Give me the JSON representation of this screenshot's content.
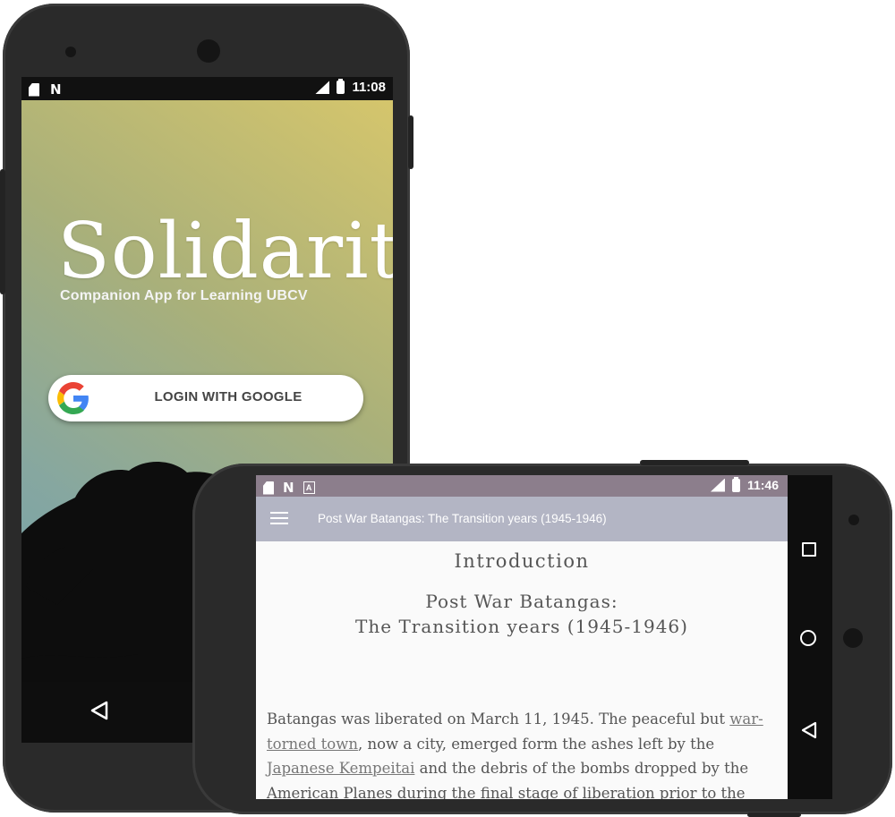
{
  "portrait": {
    "status_time": "11:08",
    "status_left_icons": [
      "sim-card-icon",
      "nfc-icon"
    ],
    "status_right_icons": [
      "lte-signal-icon",
      "battery-icon"
    ],
    "app_title": "Solidarity",
    "app_subtitle": "Companion App for Learning UBCV",
    "login_button_label": "LOGIN WITH GOOGLE",
    "nav_icons": [
      "back-icon"
    ]
  },
  "landscape": {
    "status_time": "11:46",
    "status_left_icons": [
      "sim-card-icon",
      "nfc-icon",
      "a-icon"
    ],
    "status_right_icons": [
      "lte-signal-icon",
      "battery-icon"
    ],
    "toolbar_title": "Post War Batangas: The Transition years (1945-1946)",
    "heading": "Introduction",
    "subtitle_line1": "Post War Batangas:",
    "subtitle_line2": "The Transition years (1945-1946)",
    "body": {
      "seg1": "Batangas was liberated on March 11, 1945. The peaceful but ",
      "link1": "war-torned town",
      "seg2": ", now a city, emerged form the ashes left by the ",
      "link2": "Japanese Kempeitai",
      "seg3": " and the debris of the bombs dropped by the American Planes during the final stage of liberation prior to the"
    },
    "nav_icons": [
      "recents-icon",
      "home-icon",
      "back-icon"
    ]
  },
  "colors": {
    "status_bar_landscape": "#8c7e8c",
    "toolbar_landscape": "#b3b5c4",
    "gradient_top": "#d8c76b",
    "gradient_bottom": "#6b9fb2"
  }
}
